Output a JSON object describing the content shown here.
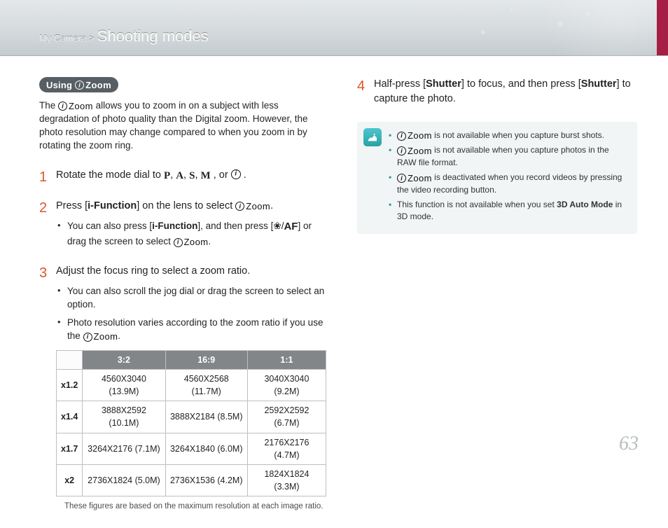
{
  "header": {
    "crumb_small": "My Camera",
    "separator": ">",
    "crumb_large": "Shooting modes"
  },
  "using_pill": {
    "label": "Using",
    "zoom_label": "Zoom"
  },
  "intro": {
    "pre": "The ",
    "zoom_label": "Zoom",
    "post": " allows you to zoom in on a subject with less degradation of photo quality than the Digital zoom. However, the photo resolution may change compared to when you zoom in by rotating the zoom ring."
  },
  "step1": {
    "pre": "Rotate the mode dial to ",
    "modes": [
      "P",
      "A",
      "S",
      "M"
    ],
    "sep": ", ",
    "or": ", or ",
    "post": "."
  },
  "step2": {
    "pre": "Press [",
    "fn": "i-Function",
    "mid": "] on the lens to select ",
    "zoom_label": "Zoom",
    "post": ".",
    "sub1_pre": "You can also press [",
    "sub1_fn": "i-Function",
    "sub1_mid": "], and then press [",
    "sub1_glyph1": "⚙",
    "sub1_slash": "/",
    "sub1_glyph2": "AF",
    "sub1_mid2": "] or drag the screen to select ",
    "sub1_zoom": "Zoom",
    "sub1_post": "."
  },
  "step3": {
    "text": "Adjust the focus ring to select a zoom ratio.",
    "sub1": "You can also scroll the jog dial or drag the screen to select an option.",
    "sub2_pre": "Photo resolution varies according to the zoom ratio if you use the ",
    "sub2_zoom": "Zoom",
    "sub2_post": "."
  },
  "table": {
    "headers": [
      "3:2",
      "16:9",
      "1:1"
    ],
    "rows": [
      {
        "label": "x1.2",
        "cells": [
          "4560X3040 (13.9M)",
          "4560X2568 (11.7M)",
          "3040X3040 (9.2M)"
        ]
      },
      {
        "label": "x1.4",
        "cells": [
          "3888X2592 (10.1M)",
          "3888X2184 (8.5M)",
          "2592X2592 (6.7M)"
        ]
      },
      {
        "label": "x1.7",
        "cells": [
          "3264X2176 (7.1M)",
          "3264X1840 (6.0M)",
          "2176X2176 (4.7M)"
        ]
      },
      {
        "label": "x2",
        "cells": [
          "2736X1824 (5.0M)",
          "2736X1536 (4.2M)",
          "1824X1824 (3.3M)"
        ]
      }
    ],
    "footnote": "These figures are based on the maximum resolution at each image ratio."
  },
  "step4": {
    "pre": "Half-press [",
    "s1": "Shutter",
    "mid": "] to focus, and then press [",
    "s2": "Shutter",
    "post": "] to capture the photo."
  },
  "notes": {
    "n1": {
      "zoom": "Zoom",
      "text": " is not available when you capture burst shots."
    },
    "n2": {
      "zoom": "Zoom",
      "text": " is not available when you capture photos in the RAW file format."
    },
    "n3": {
      "zoom": "Zoom",
      "text": " is deactivated when you record videos by pressing the video recording button."
    },
    "n4": {
      "pre": "This function is not available when you set ",
      "bold": "3D Auto Mode",
      "post": " in 3D mode."
    }
  },
  "page_number": "63"
}
